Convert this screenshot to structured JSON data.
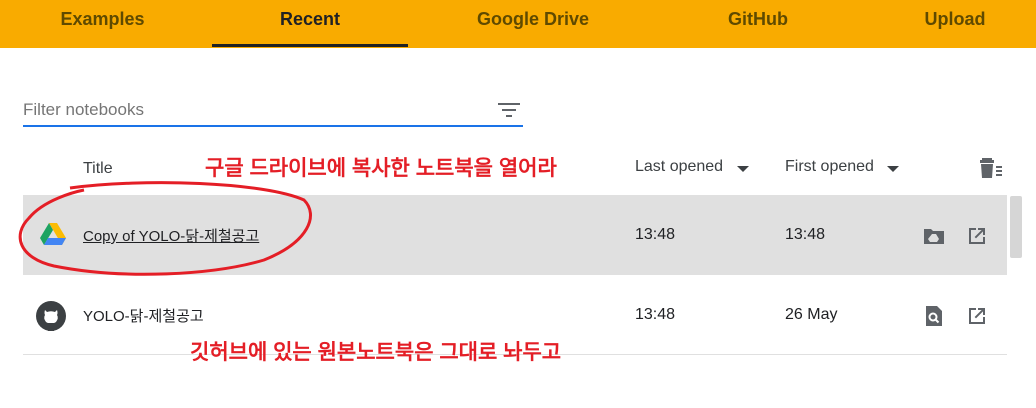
{
  "tabs": [
    {
      "label": "Examples",
      "active": false
    },
    {
      "label": "Recent",
      "active": true
    },
    {
      "label": "Google Drive",
      "active": false
    },
    {
      "label": "GitHub",
      "active": false
    },
    {
      "label": "Upload",
      "active": false
    }
  ],
  "filter": {
    "placeholder": "Filter notebooks",
    "value": ""
  },
  "columns": {
    "title": "Title",
    "last_opened": "Last opened",
    "first_opened": "First opened"
  },
  "rows": [
    {
      "title": "Copy of YOLO-닭-제철공고",
      "last_opened": "13:48",
      "first_opened": "13:48",
      "source_icon": "google-drive-icon",
      "action_icon": "drive-folder-icon"
    },
    {
      "title": "YOLO-닭-제철공고",
      "last_opened": "13:48",
      "first_opened": "26 May",
      "source_icon": "github-icon",
      "action_icon": "search-document-icon"
    }
  ],
  "annotations": {
    "top": "구글 드라이브에 복사한 노트북을 열어라",
    "bottom": "깃허브에 있는 원본노트북은 그대로 놔두고"
  },
  "colors": {
    "tab_bar": "#f9ab00",
    "annotation": "#e41e26",
    "accent": "#1a73e8",
    "selected_row": "#e0e0e0"
  }
}
